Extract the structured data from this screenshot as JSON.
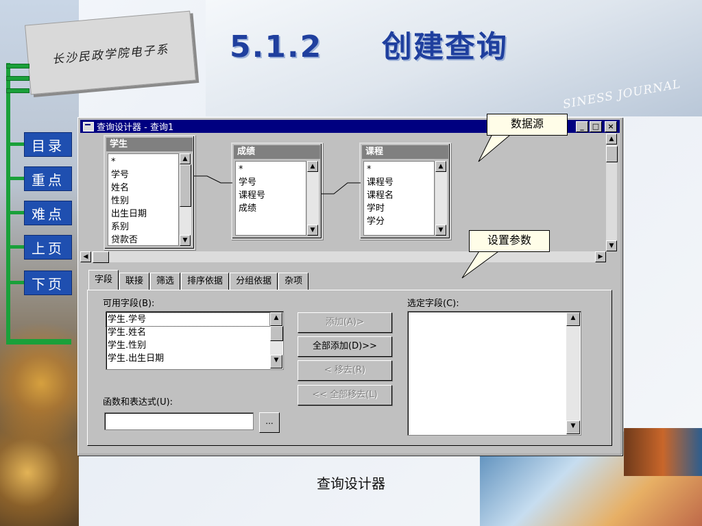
{
  "slide": {
    "org_logo_text": "长沙民政学院电子系",
    "title": "5.1.2     创建查询",
    "caption": "查询设计器",
    "background_text": "SINESS JOURNAL"
  },
  "nav": {
    "items": [
      {
        "label": "目录"
      },
      {
        "label": "重点"
      },
      {
        "label": "难点"
      },
      {
        "label": "上页"
      },
      {
        "label": "下页"
      }
    ]
  },
  "window": {
    "title": "查询设计器 - 查询1",
    "min_glyph": "_",
    "max_glyph": "□",
    "close_glyph": "×"
  },
  "tables": [
    {
      "name": "学生",
      "fields": [
        "*",
        "学号",
        "姓名",
        "性别",
        "出生日期",
        "系别",
        "贷款否"
      ]
    },
    {
      "name": "成绩",
      "fields": [
        "*",
        "学号",
        "课程号",
        "成绩"
      ]
    },
    {
      "name": "课程",
      "fields": [
        "*",
        "课程号",
        "课程名",
        "学时",
        "学分"
      ]
    }
  ],
  "tabs": [
    {
      "label": "字段"
    },
    {
      "label": "联接"
    },
    {
      "label": "筛选"
    },
    {
      "label": "排序依据"
    },
    {
      "label": "分组依据"
    },
    {
      "label": "杂项"
    }
  ],
  "fields_tab": {
    "available_label": "可用字段(B):",
    "available": [
      "学生.学号",
      "学生.姓名",
      "学生.性别",
      "学生.出生日期"
    ],
    "selected_label": "选定字段(C):",
    "buttons": {
      "add": "添加(A)>",
      "add_all": "全部添加(D)>>",
      "remove": "< 移去(R)",
      "remove_all": "<< 全部移去(L)"
    },
    "expr_label": "函数和表达式(U):",
    "expr_value": "",
    "expr_button": "..."
  },
  "callouts": {
    "datasource": "数据源",
    "params": "设置参数"
  }
}
